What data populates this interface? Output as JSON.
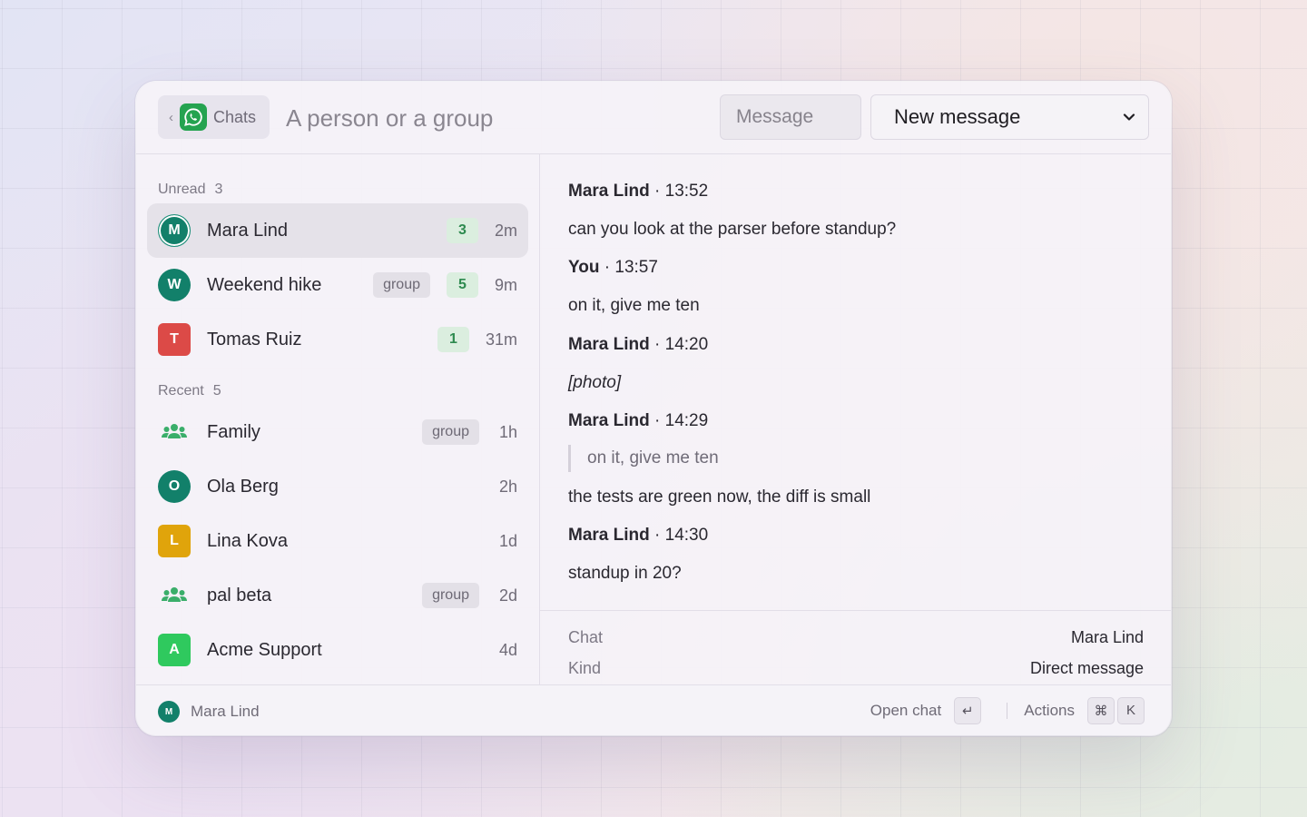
{
  "header": {
    "back_label": "Chats",
    "search_placeholder": "A person or a group",
    "message_placeholder": "Message",
    "select_value": "New message",
    "app_icon": "whatsapp-icon"
  },
  "sections": {
    "unread": {
      "title": "Unread",
      "count": "3"
    },
    "recent": {
      "title": "Recent",
      "count": "5"
    }
  },
  "chats": [
    {
      "name": "Mara Lind",
      "initial": "M",
      "avatar_color": "#12806a",
      "time": "2m",
      "unread": "3",
      "tag": ""
    },
    {
      "name": "Weekend hike",
      "initial": "W",
      "avatar_color": "#12806a",
      "time": "9m",
      "unread": "5",
      "tag": "group"
    },
    {
      "name": "Tomas Ruiz",
      "initial": "T",
      "avatar_color": "#dc4a47",
      "time": "31m",
      "unread": "1",
      "tag": ""
    },
    {
      "name": "Family",
      "icon": "group-icon",
      "time": "1h",
      "tag": "group"
    },
    {
      "name": "Ola Berg",
      "initial": "O",
      "avatar_color": "#12806a",
      "time": "2h",
      "tag": ""
    },
    {
      "name": "Lina Kova",
      "initial": "L",
      "avatar_color": "#e0a40b",
      "time": "1d",
      "tag": ""
    },
    {
      "name": "pal beta",
      "icon": "group-icon",
      "time": "2d",
      "tag": "group"
    },
    {
      "name": "Acme Support",
      "initial": "A",
      "avatar_color": "#2fc95e",
      "time": "4d",
      "tag": ""
    }
  ],
  "messages": [
    {
      "sender": "Mara Lind",
      "time": "13:52",
      "text": "can you look at the parser before standup?"
    },
    {
      "sender": "You",
      "time": "13:57",
      "text": "on it, give me ten"
    },
    {
      "sender": "Mara Lind",
      "time": "14:20",
      "text": "[photo]"
    },
    {
      "sender": "Mara Lind",
      "time": "14:29",
      "quote": "on it, give me ten",
      "text": "the tests are green now, the diff is small"
    },
    {
      "sender": "Mara Lind",
      "time": "14:30",
      "text": "standup in 20?"
    }
  ],
  "meta": [
    {
      "key": "Chat",
      "value": "Mara Lind"
    },
    {
      "key": "Kind",
      "value": "Direct message"
    }
  ],
  "footer": {
    "avatar_initial": "M",
    "name": "Mara Lind",
    "open_label": "Open chat",
    "open_key": "↵",
    "actions_label": "Actions",
    "actions_keys": [
      "⌘",
      "K"
    ]
  },
  "colors": {
    "accent_green": "#25a350",
    "badge_bg": "#dbeedf",
    "badge_text": "#2e8a4f",
    "group_icon": "#3aae6a"
  }
}
